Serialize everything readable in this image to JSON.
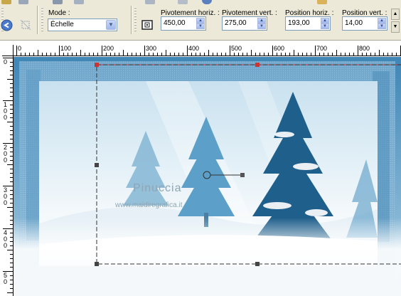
{
  "toolbar": {
    "mode": {
      "label": "Mode :",
      "value": "Échelle"
    },
    "rotation_x": {
      "label": "Pivotement horiz. :",
      "value": "450,00"
    },
    "rotation_y": {
      "label": "Pivotement vert. :",
      "value": "275,00"
    },
    "position_x": {
      "label": "Position horiz. :",
      "value": "193,00"
    },
    "position_y": {
      "label": "Position vert. :",
      "value": "14,00"
    }
  },
  "ruler": {
    "horizontal": [
      "0",
      "100",
      "200",
      "300",
      "400",
      "500",
      "600",
      "700",
      "800"
    ],
    "vertical": [
      "0",
      "1\n0\n0",
      "2\n0\n0",
      "3\n0\n0",
      "4\n0\n0",
      "5\n0"
    ]
  },
  "canvas": {
    "watermark_name": "Pinuccia",
    "watermark_url": "www.maidiregrafica.it"
  },
  "colors": {
    "toolbar_bg": "#ece9d8",
    "selection_line": "#333333",
    "guide_red": "#cc3333"
  }
}
